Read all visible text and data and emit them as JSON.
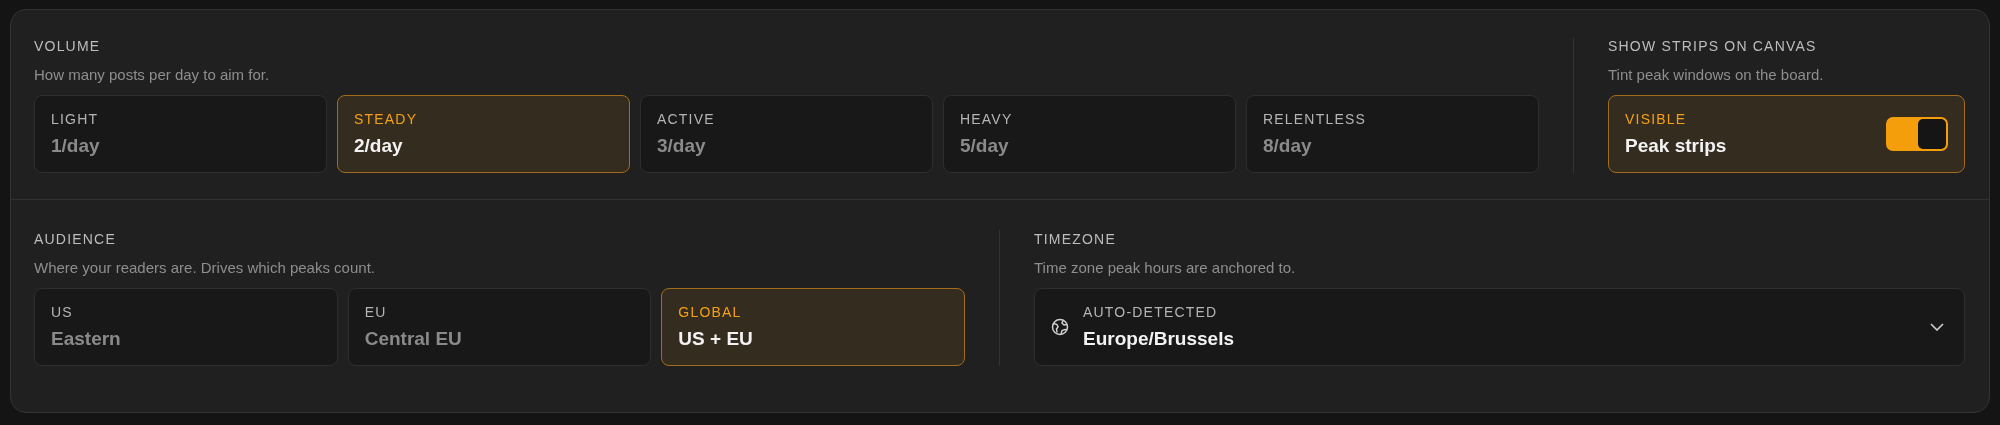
{
  "volume": {
    "label": "VOLUME",
    "description": "How many posts per day to aim for.",
    "options": [
      {
        "label": "LIGHT",
        "value": "1/day",
        "selected": false
      },
      {
        "label": "STEADY",
        "value": "2/day",
        "selected": true
      },
      {
        "label": "ACTIVE",
        "value": "3/day",
        "selected": false
      },
      {
        "label": "HEAVY",
        "value": "5/day",
        "selected": false
      },
      {
        "label": "RELENTLESS",
        "value": "8/day",
        "selected": false
      }
    ]
  },
  "strips": {
    "label": "SHOW STRIPS ON CANVAS",
    "description": "Tint peak windows on the board.",
    "toggle": {
      "caption": "VISIBLE",
      "label": "Peak strips",
      "on": true
    }
  },
  "audience": {
    "label": "AUDIENCE",
    "description": "Where your readers are. Drives which peaks count.",
    "options": [
      {
        "label": "US",
        "value": "Eastern",
        "selected": false
      },
      {
        "label": "EU",
        "value": "Central EU",
        "selected": false
      },
      {
        "label": "GLOBAL",
        "value": "US + EU",
        "selected": true
      }
    ]
  },
  "timezone": {
    "label": "TIMEZONE",
    "description": "Time zone peak hours are anchored to.",
    "select": {
      "caption": "AUTO-DETECTED",
      "value": "Europe/Brussels"
    }
  }
}
